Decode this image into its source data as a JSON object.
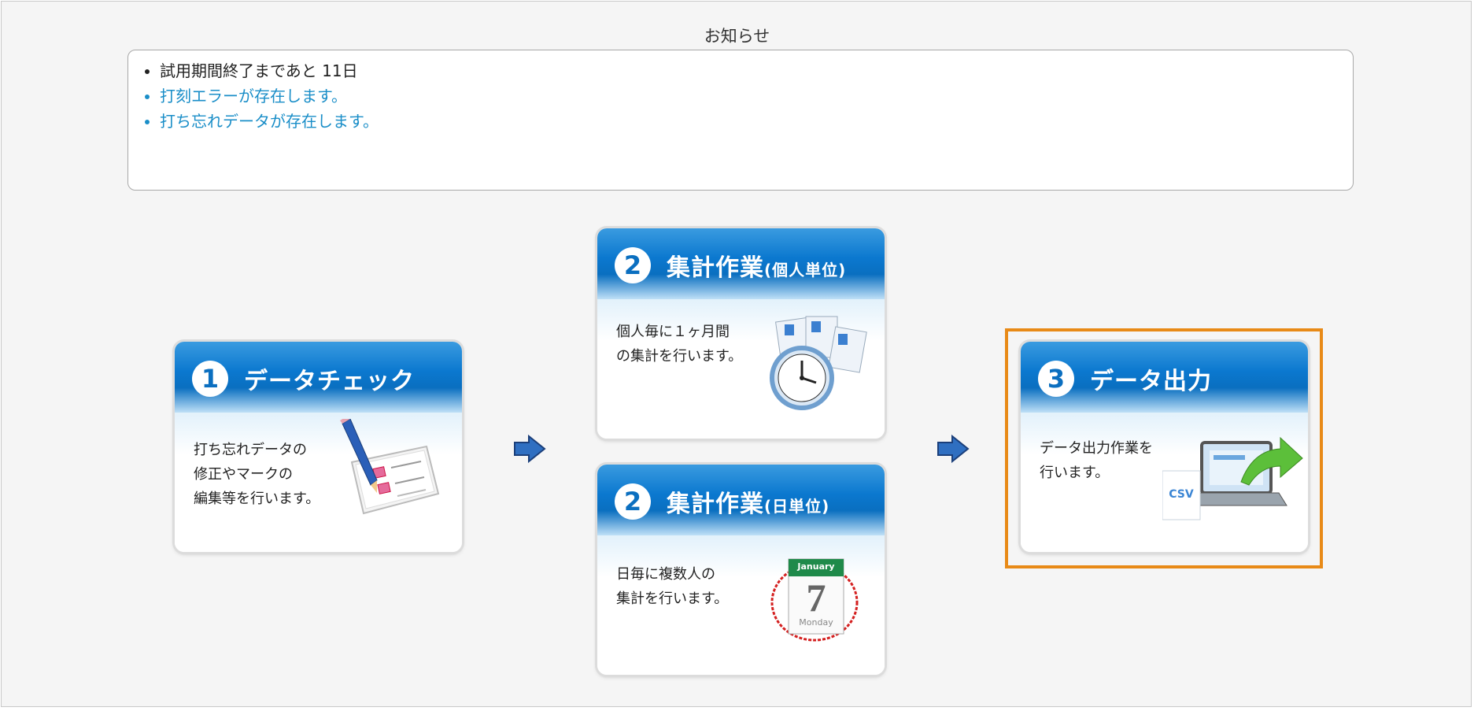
{
  "notice": {
    "title": "お知らせ",
    "items": [
      {
        "text": "試用期間終了まであと 11日"
      },
      {
        "text": "打刻エラーが存在します。"
      },
      {
        "text": "打ち忘れデータが存在します。"
      }
    ]
  },
  "cards": {
    "data_check": {
      "number": "1",
      "title": "データチェック",
      "description": "打ち忘れデータの\n修正やマークの\n編集等を行います。",
      "icon": "pencil-checklist-icon"
    },
    "tally_individual": {
      "number": "2",
      "title": "集計作業",
      "title_suffix": "(個人単位)",
      "description": "個人毎に１ヶ月間\nの集計を行います。",
      "icon": "clock-timecards-icon"
    },
    "tally_daily": {
      "number": "2",
      "title": "集計作業",
      "title_suffix": "(日単位)",
      "description": "日毎に複数人の\n集計を行います。",
      "icon": "calendar-icon",
      "calendar_month": "January",
      "calendar_day": "7",
      "calendar_weekday": "Monday"
    },
    "data_output": {
      "number": "3",
      "title": "データ出力",
      "description": "データ出力作業を\n行います。",
      "icon": "csv-export-laptop-icon",
      "csv_label": "CSV"
    }
  },
  "colors": {
    "accent_blue": "#0b78cf",
    "link": "#1a8ec8",
    "highlight": "#e88a17"
  }
}
